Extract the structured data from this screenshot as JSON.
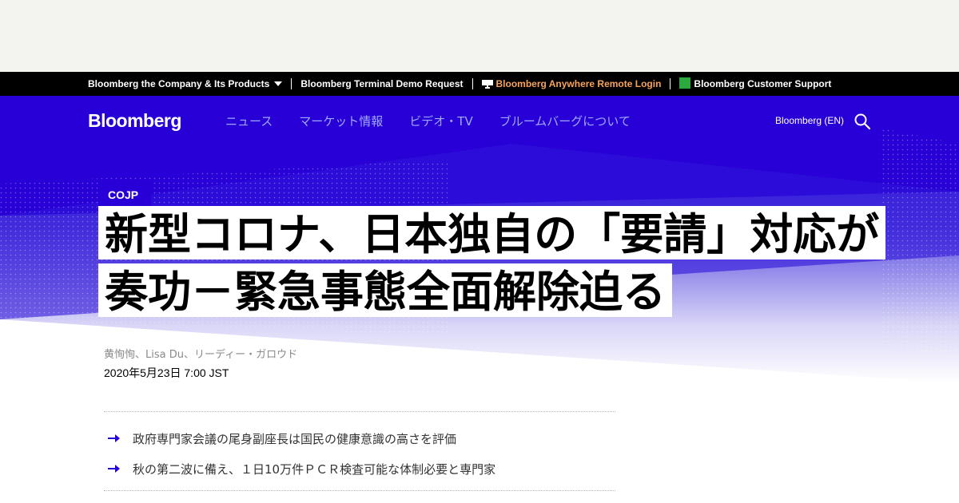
{
  "topbar": {
    "company_label": "Bloomberg the Company & Its Products",
    "terminal_demo_label": "Bloomberg Terminal Demo Request",
    "anywhere_label": "Bloomberg Anywhere Remote Login",
    "support_label": "Bloomberg Customer Support"
  },
  "header": {
    "brand": "Bloomberg",
    "nav": [
      "ニュース",
      "マーケット情報",
      "ビデオ・TV",
      "ブルームバーグについて"
    ],
    "lang_label": "Bloomberg (EN)"
  },
  "article": {
    "kicker": "COJP",
    "headline": "新型コロナ、日本独自の「要請」対応が奏功－緊急事態全面解除迫る",
    "byline": "黄恂恂、Lisa Du、リーディー・ガロウド",
    "date": "2020年5月23日 7:00 JST",
    "bullets": [
      "政府専門家会議の尾身副座長は国民の健康意識の高さを評価",
      "秋の第二波に備え、１日10万件ＰＣＲ検査可能な体制必要と専門家"
    ]
  },
  "colors": {
    "brand_blue": "#2800d7",
    "nav_text": "#9fa8ff",
    "topbar_bg": "#000000",
    "link_orange": "#f8a35b"
  },
  "icons": {
    "caret": "chevron-down-icon",
    "anywhere": "monitor-icon",
    "support": "help-icon",
    "search": "search-icon",
    "bullet": "arrow-right-icon"
  }
}
